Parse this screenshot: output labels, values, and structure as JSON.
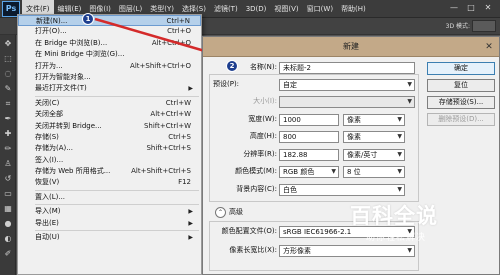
{
  "app": {
    "logo": "Ps",
    "menu": [
      "文件(F)",
      "编辑(E)",
      "图像(I)",
      "图层(L)",
      "类型(Y)",
      "选择(S)",
      "滤镜(T)",
      "3D(D)",
      "视图(V)",
      "窗口(W)",
      "帮助(H)"
    ],
    "options_bar": {
      "mode_3d_label": "3D 模式:"
    },
    "window_controls": [
      "—",
      "□",
      "✕"
    ]
  },
  "file_menu": {
    "items": [
      {
        "label": "新建(N)...",
        "shortcut": "Ctrl+N",
        "highlighted": true
      },
      {
        "label": "打开(O)...",
        "shortcut": "Ctrl+O"
      },
      {
        "label": "在 Bridge 中浏览(B)...",
        "shortcut": "Alt+Ctrl+O"
      },
      {
        "label": "在 Mini Bridge 中浏览(G)...",
        "shortcut": ""
      },
      {
        "label": "打开为...",
        "shortcut": "Alt+Shift+Ctrl+O"
      },
      {
        "label": "打开为智能对象...",
        "shortcut": ""
      },
      {
        "label": "最近打开文件(T)",
        "shortcut": "",
        "submenu": true
      },
      {
        "sep": true
      },
      {
        "label": "关闭(C)",
        "shortcut": "Ctrl+W"
      },
      {
        "label": "关闭全部",
        "shortcut": "Alt+Ctrl+W"
      },
      {
        "label": "关闭并转到 Bridge...",
        "shortcut": "Shift+Ctrl+W"
      },
      {
        "label": "存储(S)",
        "shortcut": "Ctrl+S"
      },
      {
        "label": "存储为(A)...",
        "shortcut": "Shift+Ctrl+S"
      },
      {
        "label": "签入(I)...",
        "shortcut": ""
      },
      {
        "label": "存储为 Web 所用格式...",
        "shortcut": "Alt+Shift+Ctrl+S"
      },
      {
        "label": "恢复(V)",
        "shortcut": "F12"
      },
      {
        "sep": true
      },
      {
        "label": "置入(L)...",
        "shortcut": ""
      },
      {
        "sep": true
      },
      {
        "label": "导入(M)",
        "shortcut": "",
        "submenu": true
      },
      {
        "label": "导出(E)",
        "shortcut": "",
        "submenu": true
      },
      {
        "sep": true
      },
      {
        "label": "自动(U)",
        "shortcut": "",
        "submenu": true
      }
    ]
  },
  "annotations": {
    "badge1": "1",
    "badge2": "2"
  },
  "dialog": {
    "title": "新建",
    "name_label": "名称(N):",
    "name_value": "未标题-2",
    "preset_label": "预设(P):",
    "preset_value": "自定",
    "size_label": "大小(I):",
    "size_value": "",
    "width_label": "宽度(W):",
    "width_value": "1000",
    "width_unit": "像素",
    "height_label": "高度(H):",
    "height_value": "800",
    "height_unit": "像素",
    "resolution_label": "分辨率(R):",
    "resolution_value": "182.88",
    "resolution_unit": "像素/英寸",
    "color_mode_label": "颜色模式(M):",
    "color_mode_value": "RGB 颜色",
    "bit_depth": "8 位",
    "background_label": "背景内容(C):",
    "background_value": "白色",
    "advanced_label": "高级",
    "profile_label": "颜色配置文件(O):",
    "profile_value": "sRGB IEC61966-2.1",
    "pixel_aspect_label": "像素长宽比(X):",
    "pixel_aspect_value": "方形像素",
    "buttons": {
      "ok": "确定",
      "cancel": "复位",
      "save_preset": "存储预设(S)...",
      "delete_preset": "删除预设(D)..."
    }
  },
  "watermark": {
    "title": "百科全说",
    "subtitle": "助你轻松解决"
  }
}
